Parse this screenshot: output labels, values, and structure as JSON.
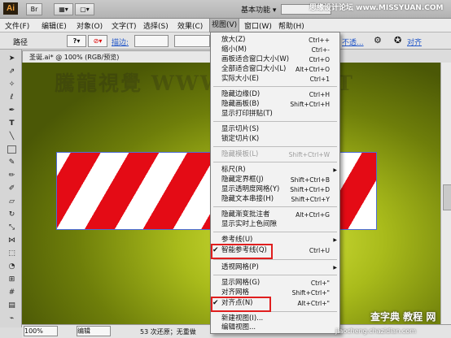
{
  "appbar": {
    "logo": "Ai",
    "workspace": "基本功能 ▾",
    "watermark": "思缘设计论坛 www.MISSYUAN.COM"
  },
  "menubar": {
    "items": [
      "文件(F)",
      "编辑(E)",
      "对象(O)",
      "文字(T)",
      "选择(S)",
      "效果(C)",
      "视图(V)",
      "窗口(W)",
      "帮助(H)"
    ]
  },
  "control": {
    "label": "路径",
    "stroke_label": "描边:",
    "opacity_label": "不透...",
    "align_label": "对齐"
  },
  "document": {
    "tab": "圣诞.ai* @ 100% (RGB/预览)",
    "watermark": "騰龍視覺 WWW.TTLY.NET"
  },
  "status": {
    "zoom": "100%",
    "mode": "编辑",
    "info": "53 次还原；无重做"
  },
  "view_menu": {
    "items": [
      {
        "label": "放大(Z)",
        "shortcut": "Ctrl++"
      },
      {
        "label": "缩小(M)",
        "shortcut": "Ctrl+-"
      },
      {
        "label": "画板适合窗口大小(W)",
        "shortcut": "Ctrl+O"
      },
      {
        "label": "全部适合窗口大小(L)",
        "shortcut": "Alt+Ctrl+O"
      },
      {
        "label": "实际大小(E)",
        "shortcut": "Ctrl+1"
      },
      {
        "label": "隐藏边缘(D)",
        "shortcut": "Ctrl+H"
      },
      {
        "label": "隐藏画板(B)",
        "shortcut": "Shift+Ctrl+H"
      },
      {
        "label": "显示打印拼贴(T)",
        "shortcut": ""
      },
      {
        "label": "显示切片(S)",
        "shortcut": ""
      },
      {
        "label": "锁定切片(K)",
        "shortcut": ""
      },
      {
        "label": "隐藏模板(L)",
        "shortcut": "Shift+Ctrl+W"
      },
      {
        "label": "标尺(R)",
        "shortcut": ""
      },
      {
        "label": "隐藏定界框(J)",
        "shortcut": "Shift+Ctrl+B"
      },
      {
        "label": "显示透明度网格(Y)",
        "shortcut": "Shift+Ctrl+D"
      },
      {
        "label": "隐藏文本串接(H)",
        "shortcut": "Shift+Ctrl+Y"
      },
      {
        "label": "隐藏渐变批注者",
        "shortcut": "Alt+Ctrl+G"
      },
      {
        "label": "显示实时上色间隙",
        "shortcut": ""
      },
      {
        "label": "参考线(U)",
        "shortcut": ""
      },
      {
        "label": "智能参考线(Q)",
        "shortcut": "Ctrl+U"
      },
      {
        "label": "透视网格(P)",
        "shortcut": ""
      },
      {
        "label": "显示网格(G)",
        "shortcut": "Ctrl+\""
      },
      {
        "label": "对齐网格",
        "shortcut": "Shift+Ctrl+\""
      },
      {
        "label": "对齐点(N)",
        "shortcut": "Alt+Ctrl+\""
      },
      {
        "label": "新建视图(I)...",
        "shortcut": ""
      },
      {
        "label": "编辑视图...",
        "shortcut": ""
      }
    ]
  },
  "corner_logo": {
    "main": "查字典 教程 网",
    "sub": "jiaocheng.chazidian.com"
  }
}
